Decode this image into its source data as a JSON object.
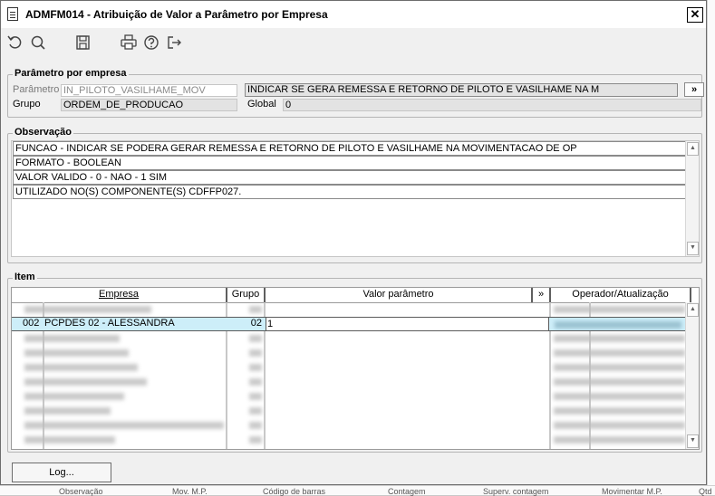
{
  "window": {
    "title": "ADMFM014 - Atribuição de Valor a Parâmetro por Empresa",
    "close_label": "✕"
  },
  "toolbar": {
    "icons": [
      "undo-icon",
      "search-icon",
      "save-icon",
      "print-icon",
      "help-icon",
      "exit-icon"
    ]
  },
  "parametro_empresa": {
    "legend": "Parâmetro por empresa",
    "parametro_label": "Parâmetro",
    "parametro_value": "IN_PILOTO_VASILHAME_MOV",
    "parametro_desc": "INDICAR SE GERA REMESSA E RETORNO DE PILOTO E VASILHAME NA M",
    "more_label": "»",
    "grupo_label": "Grupo",
    "grupo_value": "ORDEM_DE_PRODUCAO",
    "global_label": "Global",
    "global_value": "0"
  },
  "observacao": {
    "legend": "Observação",
    "lines": [
      "FUNCAO - INDICAR SE PODERA GERAR REMESSA E RETORNO DE PILOTO E VASILHAME NA MOVIMENTACAO DE OP",
      "FORMATO - BOOLEAN",
      "VALOR VALIDO - 0 - NAO - 1 SIM",
      "UTILIZADO NO(S) COMPONENTE(S) CDFFP027."
    ]
  },
  "item": {
    "legend": "Item",
    "columns": {
      "empresa": "Empresa",
      "grupo": "Grupo",
      "valor": "Valor parâmetro",
      "more": "»",
      "operador": "Operador/Atualização"
    },
    "selected_row": {
      "code": "002",
      "empresa": "PCPDES 02 - ALESSANDRA",
      "grupo": "02",
      "valor": "1"
    },
    "selected_row_color": "#cdeef9"
  },
  "footer": {
    "log_label": "Log..."
  },
  "background_strip": {
    "items": [
      "Observação",
      "Mov. M.P.",
      "Código de barras",
      "Contagem",
      "Superv. contagem",
      "Movimentar M.P.",
      "Qtd"
    ]
  }
}
